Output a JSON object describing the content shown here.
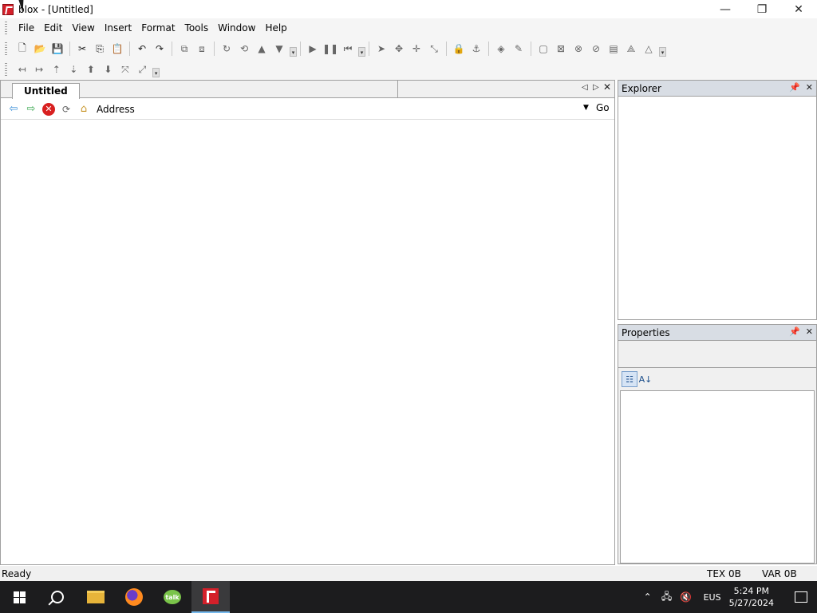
{
  "window": {
    "title": "Roblox - [Untitled]",
    "title_visible": "blox - [Untitled]",
    "controls": {
      "minimize": "—",
      "maximize": "❐",
      "close": "✕"
    }
  },
  "menu": {
    "items": [
      "File",
      "Edit",
      "View",
      "Insert",
      "Format",
      "Tools",
      "Window",
      "Help"
    ]
  },
  "toolbar1": {
    "icons": [
      "new-icon",
      "open-icon",
      "save-icon",
      "cut-icon",
      "copy-icon",
      "paste-icon",
      "undo-icon",
      "redo-icon",
      "group-icon",
      "ungroup-icon",
      "rotate-icon",
      "tilt-icon",
      "move-up-icon",
      "move-down-icon",
      "play-icon",
      "pause-icon",
      "reset-icon",
      "select-icon",
      "drag-icon",
      "move-icon",
      "resize-icon",
      "lock-icon",
      "anchor-icon",
      "fill-icon",
      "paint-icon",
      "part-icon",
      "weld-icon",
      "hinge-icon",
      "motor-icon",
      "glue-icon",
      "studs-icon",
      "inlet-icon"
    ]
  },
  "toolbar2": {
    "icons": [
      "axis-left-icon",
      "axis-right-icon",
      "axis-up-icon",
      "axis-down-icon",
      "raise-icon",
      "lower-icon",
      "zoom-in-icon",
      "zoom-out-icon"
    ]
  },
  "document": {
    "tab_label": "Untitled",
    "address_label": "Address",
    "address_value": "",
    "go_label": "Go"
  },
  "explorer": {
    "title": "Explorer"
  },
  "properties": {
    "title": "Properties"
  },
  "status": {
    "ready": "Ready",
    "tex": "TEX 0B",
    "var": "VAR 0B"
  },
  "taskbar": {
    "apps": [
      "start",
      "search",
      "file-explorer",
      "firefox",
      "talk",
      "roblox"
    ],
    "lang": "EUS",
    "time": "5:24 PM",
    "date": "5/27/2024"
  },
  "colors": {
    "accent": "#d4202a",
    "panel_header": "#d8dde4",
    "taskbar": "#1c1c1e"
  }
}
